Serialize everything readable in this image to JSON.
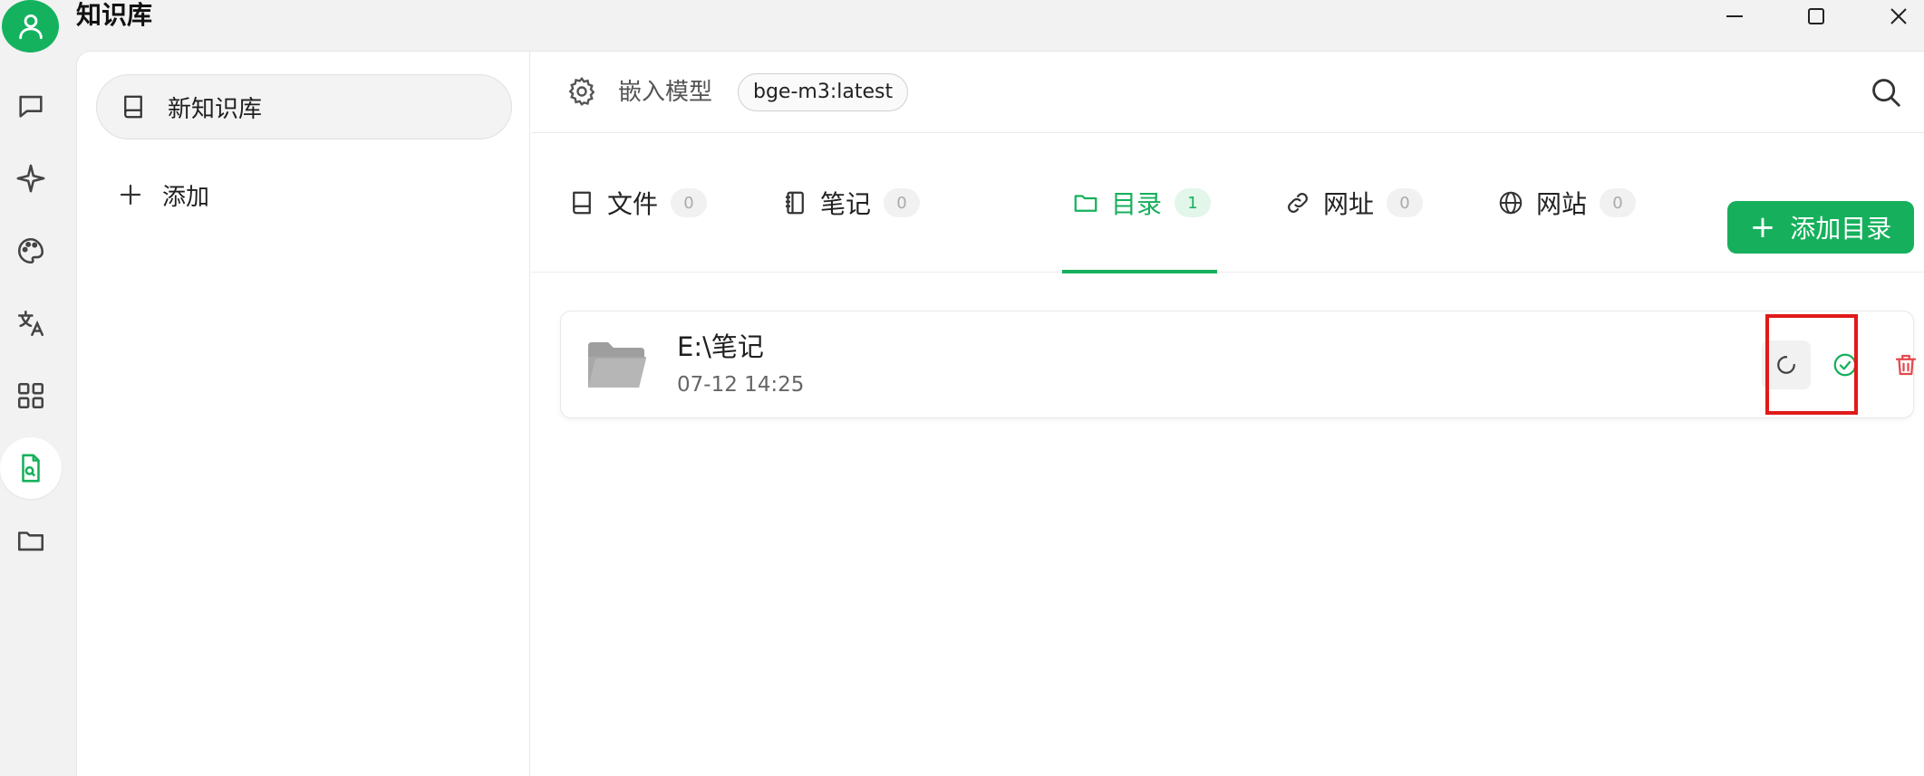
{
  "app": {
    "title": "知识库"
  },
  "window_controls": [
    "minimize-icon",
    "maximize-icon",
    "close-icon"
  ],
  "rail": {
    "items": [
      {
        "name": "chat",
        "icon": "chat-bubble-icon",
        "active": false
      },
      {
        "name": "agents",
        "icon": "sparkle-icon",
        "active": false
      },
      {
        "name": "paintings",
        "icon": "palette-icon",
        "active": false
      },
      {
        "name": "translate",
        "icon": "translate-icon",
        "active": false
      },
      {
        "name": "apps",
        "icon": "grid-icon",
        "active": false
      },
      {
        "name": "knowledge",
        "icon": "doc-search-icon",
        "active": true
      },
      {
        "name": "files",
        "icon": "folder-icon",
        "active": false
      }
    ]
  },
  "knowledge_list": {
    "items": [
      {
        "label": "新知识库",
        "icon": "book-icon"
      }
    ],
    "add_label": "添加"
  },
  "header": {
    "embed_label": "嵌入模型",
    "model": "bge-m3:latest"
  },
  "tabs": [
    {
      "label": "文件",
      "count": "0",
      "icon": "book-icon",
      "active": false
    },
    {
      "label": "笔记",
      "count": "0",
      "icon": "notebook-icon",
      "active": false
    },
    {
      "label": "目录",
      "count": "1",
      "icon": "folder-icon",
      "active": true
    },
    {
      "label": "网址",
      "count": "0",
      "icon": "link-icon",
      "active": false
    },
    {
      "label": "网站",
      "count": "0",
      "icon": "globe-icon",
      "active": false
    }
  ],
  "add_button": {
    "label": "添加目录"
  },
  "directories": [
    {
      "name": "E:\\笔记",
      "time": "07-12 14:25"
    }
  ],
  "colors": {
    "accent": "#16b05c",
    "danger": "#e5484d",
    "highlight": "#e11919"
  }
}
